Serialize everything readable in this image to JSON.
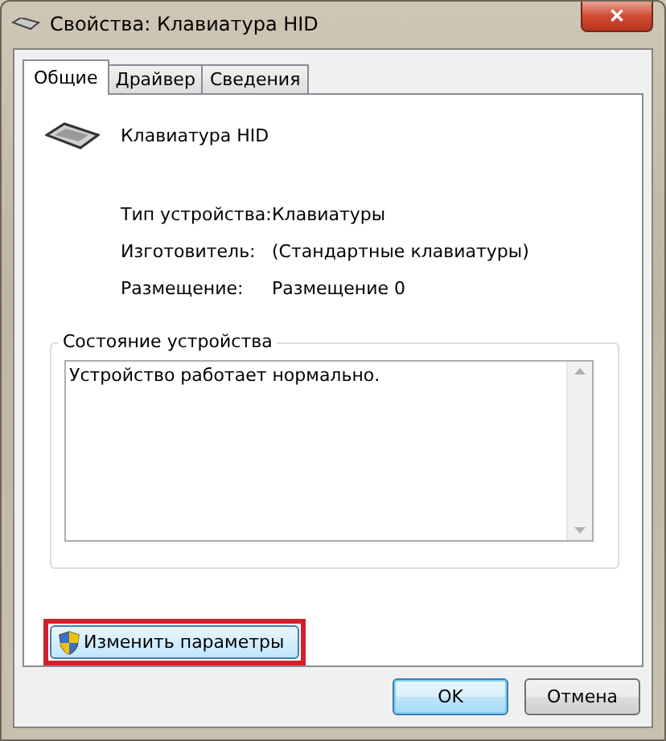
{
  "window": {
    "title": "Свойства: Клавиатура HID",
    "close": "✕"
  },
  "tabs": [
    {
      "label": "Общие",
      "selected": true
    },
    {
      "label": "Драйвер",
      "selected": false
    },
    {
      "label": "Сведения",
      "selected": false
    }
  ],
  "device": {
    "name": "Клавиатура HID"
  },
  "properties": [
    {
      "label": "Тип устройства:",
      "value": "Клавиатуры"
    },
    {
      "label": "Изготовитель:",
      "value": "(Стандартные клавиатуры)"
    },
    {
      "label": "Размещение:",
      "value": "Размещение 0"
    }
  ],
  "status": {
    "title": "Состояние устройства",
    "text": "Устройство работает нормально."
  },
  "change_button": {
    "label": "Изменить параметры",
    "highlighted": true
  },
  "buttons": [
    {
      "label": "OK",
      "default": true
    },
    {
      "label": "Отмена",
      "default": false
    }
  ]
}
